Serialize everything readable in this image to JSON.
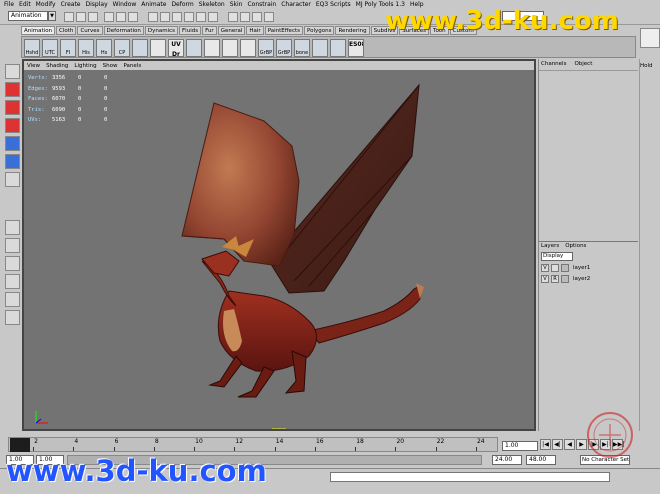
{
  "menubar": [
    "File",
    "Edit",
    "Modify",
    "Create",
    "Display",
    "Window",
    "Animate",
    "Deform",
    "Skeleton",
    "Skin",
    "Constrain",
    "Character",
    "EQ3 Scripts",
    "MJ Poly Tools 1.3",
    "Help"
  ],
  "toolbar": {
    "mode_select": "Animation"
  },
  "shelf": {
    "tabs": [
      "Animation",
      "Cloth",
      "Curves",
      "Deformation",
      "Dynamics",
      "Fluids",
      "Fur",
      "General",
      "Hair",
      "PaintEffects",
      "Polygons",
      "Rendering",
      "Subdivs",
      "Surfaces",
      "Toon",
      "Custom"
    ],
    "buttons": [
      "Hshd",
      "UTC",
      "FI",
      "His",
      "Hs",
      "CP",
      "",
      "",
      "UV Dr",
      "",
      "",
      "",
      "",
      "GrBP",
      "GrBP",
      "bone",
      "",
      "",
      "ES08"
    ]
  },
  "viewport": {
    "menu": [
      "View",
      "Shading",
      "Lighting",
      "Show",
      "Panels"
    ],
    "hud": [
      {
        "label": "Verts:",
        "v1": "3356",
        "v2": "0",
        "v3": "0"
      },
      {
        "label": "Edges:",
        "v1": "9593",
        "v2": "0",
        "v3": "0"
      },
      {
        "label": "Faces:",
        "v1": "6070",
        "v2": "0",
        "v3": "0"
      },
      {
        "label": "Tris:",
        "v1": "6090",
        "v2": "0",
        "v3": "0"
      },
      {
        "label": "UVs:",
        "v1": "5163",
        "v2": "0",
        "v3": "0"
      }
    ],
    "camera_label": "persp"
  },
  "channel_box": {
    "menu": [
      "Channels",
      "Object"
    ]
  },
  "layer_editor": {
    "menu": [
      "Layers",
      "Options"
    ],
    "display_mode": "Display",
    "layers": [
      {
        "v": "V",
        "r": "",
        "name": "layer1"
      },
      {
        "v": "V",
        "r": "R",
        "name": "layer2"
      }
    ]
  },
  "right_side": {
    "hold_label": "Hold"
  },
  "timeline": {
    "ticks": [
      "2",
      "4",
      "6",
      "8",
      "10",
      "12",
      "14",
      "16",
      "18",
      "20",
      "22",
      "24"
    ],
    "current_frame": "1.00"
  },
  "range": {
    "start": "1.00",
    "start_inner": "1.00",
    "end_inner": "24.00",
    "end": "48.00",
    "character_set": "No Character Set"
  },
  "playback_buttons": [
    "|◀",
    "◀|",
    "◀",
    "▶",
    "|▶",
    "▶|",
    "▶▶|"
  ],
  "watermark": {
    "top": "www.3d-ku.com",
    "bottom": "www.3d-ku.com"
  }
}
